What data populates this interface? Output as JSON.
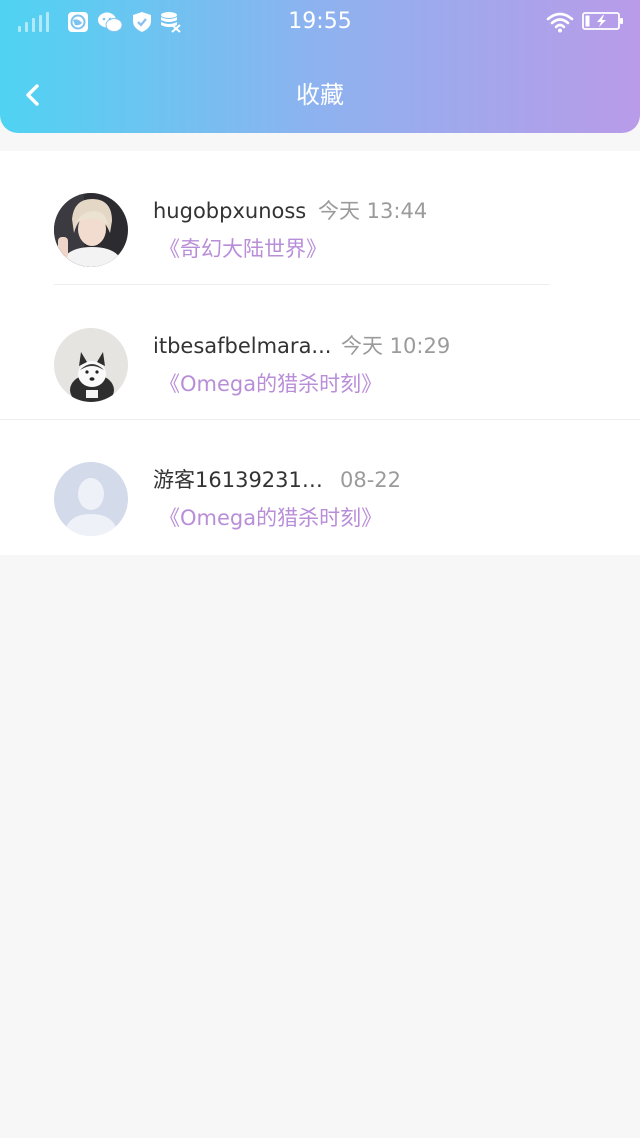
{
  "status_bar": {
    "time": "19:55",
    "icons": [
      "signal-icon",
      "browser-icon",
      "wechat-icon",
      "shield-icon",
      "storage-icon",
      "wifi-icon",
      "battery-charging-icon"
    ]
  },
  "header": {
    "title": "收藏",
    "back_icon": "chevron-left-icon"
  },
  "colors": {
    "header_gradient_start": "#4fd3f2",
    "header_gradient_end": "#b99be9",
    "book_title": "#b98ed8",
    "page_background": "#f7f7f7"
  },
  "favorites": [
    {
      "user": "hugobpxunoss",
      "time": "今天 13:44",
      "book": "《奇幻大陆世界》",
      "avatar": "photo-avatar-person"
    },
    {
      "user": "itbesafbelmara...",
      "time": "今天 10:29",
      "book": "《Omega的猎杀时刻》",
      "avatar": "photo-avatar-dog"
    },
    {
      "user": "游客16139231…",
      "time": "08-22",
      "book": "《Omega的猎杀时刻》",
      "avatar": "default-avatar-icon"
    }
  ]
}
